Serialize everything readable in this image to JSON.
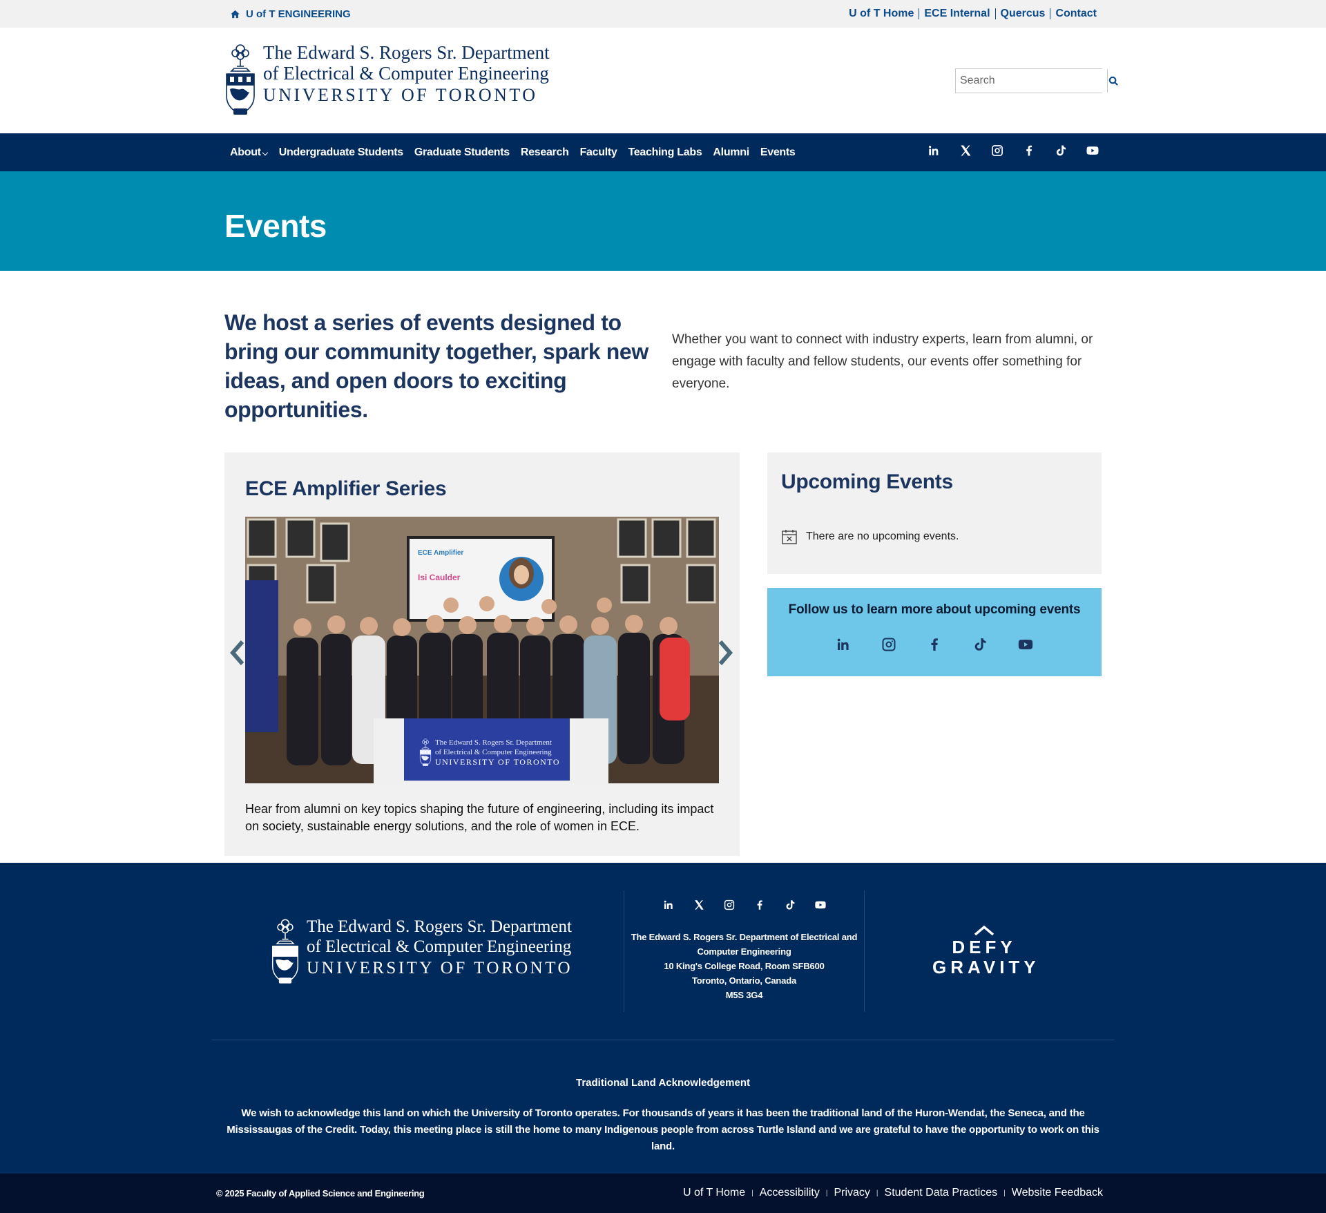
{
  "utility": {
    "brand": "U of T ENGINEERING",
    "links": [
      "U of T Home",
      "ECE Internal",
      "Quercus",
      "Contact"
    ]
  },
  "logo": {
    "line1": "The Edward S. Rogers Sr. Department",
    "line2": "of Electrical & Computer Engineering",
    "line3": "UNIVERSITY OF TORONTO"
  },
  "search": {
    "placeholder": "Search"
  },
  "nav": {
    "items": [
      "About",
      "Undergraduate Students",
      "Graduate Students",
      "Research",
      "Faculty",
      "Teaching Labs",
      "Alumni",
      "Events"
    ],
    "social_icons": [
      "linkedin-icon",
      "x-icon",
      "instagram-icon",
      "facebook-icon",
      "tiktok-icon",
      "youtube-icon"
    ]
  },
  "page": {
    "title": "Events"
  },
  "intro": {
    "lead": "We host a series of events designed to bring our community together, spark new ideas, and open doors to exciting opportunities.",
    "body": "Whether you want to connect with industry experts, learn from alumni, or engage with faculty and fellow students, our events offer something for everyone."
  },
  "amplifier": {
    "title": "ECE Amplifier Series",
    "screen_title": "ECE Amplifier",
    "screen_name": "Isi Caulder",
    "description": "Hear from alumni on key topics shaping the future of engineering, including its impact on society, sustainable energy solutions, and the role of women in ECE."
  },
  "upcoming": {
    "title": "Upcoming Events",
    "empty": "There are no upcoming events."
  },
  "follow": {
    "title": "Follow us to learn more about upcoming events",
    "icons": [
      "linkedin-icon",
      "instagram-icon",
      "facebook-icon",
      "tiktok-icon",
      "youtube-icon"
    ]
  },
  "footer": {
    "address": [
      "The Edward S. Rogers Sr. Department of Electrical and",
      "Computer Engineering",
      "10 King's College Road, Room SFB600",
      "Toronto, Ontario, Canada",
      "M5S 3G4"
    ],
    "defy1": "DEFY",
    "defy2": "GRAVITY",
    "land_heading": "Traditional Land Acknowledgement",
    "land_text": "We wish to acknowledge this land on which the University of Toronto operates. For thousands of years it has been the traditional land of the Huron-Wendat, the Seneca, and the Mississaugas of the Credit. Today, this meeting place is still the home to many Indigenous people from across Turtle Island and we are grateful to have the opportunity to work on this land."
  },
  "bottom": {
    "copyright": "© 2025 Faculty of Applied Science and Engineering",
    "links": [
      "U of T Home",
      "Accessibility",
      "Privacy",
      "Student Data Practices",
      "Website Feedback"
    ]
  },
  "colors": {
    "navy": "#002a5c",
    "teal_band": "#008bb0",
    "follow_bg": "#6ec6e8",
    "heading": "#1c355e",
    "utility_link": "#0a4b8c"
  }
}
